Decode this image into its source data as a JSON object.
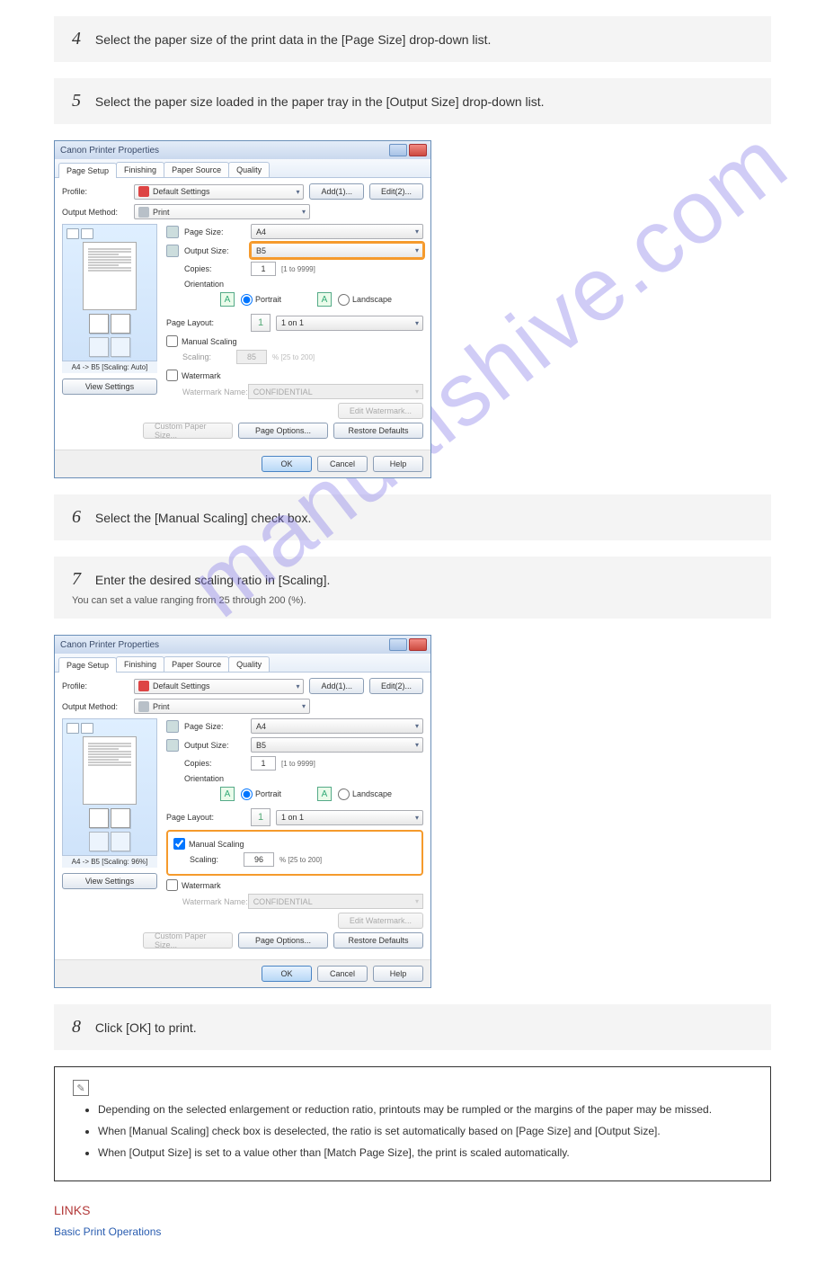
{
  "watermark": "manualshive.com",
  "steps": {
    "s4": {
      "num": "4",
      "text": "Select the paper size of the print data in the [Page Size] drop-down list."
    },
    "s5": {
      "num": "5",
      "text": "Select the paper size loaded in the paper tray in the [Output Size] drop-down list."
    },
    "s6": {
      "num": "6",
      "text": "Select the [Manual Scaling] check box."
    },
    "s7": {
      "num": "7",
      "text": "Enter the desired scaling ratio in [Scaling].",
      "sub": "You can set a value ranging from 25 through 200 (%)."
    },
    "s8": {
      "num": "8",
      "text": "Click [OK] to print."
    }
  },
  "dialog": {
    "title": "Canon Printer Properties",
    "tabs": {
      "t1": "Page Setup",
      "t2": "Finishing",
      "t3": "Paper Source",
      "t4": "Quality"
    },
    "profile_label": "Profile:",
    "profile_value": "Default Settings",
    "output_method_label": "Output Method:",
    "output_method_value": "Print",
    "add_btn": "Add(1)...",
    "edit_btn": "Edit(2)...",
    "page_size_label": "Page Size:",
    "page_size_value": "A4",
    "output_size_label": "Output Size:",
    "output_size_value": "B5",
    "copies_label": "Copies:",
    "copies_value": "1",
    "copies_range": "[1 to 9999]",
    "orientation_label": "Orientation",
    "portrait": "Portrait",
    "landscape": "Landscape",
    "page_layout_label": "Page Layout:",
    "page_layout_value": "1 on 1",
    "manual_scaling": "Manual Scaling",
    "scaling_label": "Scaling:",
    "scaling_value_dis": "85",
    "scaling_value_en": "96",
    "scaling_range": "% [25 to 200]",
    "watermark": "Watermark",
    "watermark_name": "Watermark Name:",
    "watermark_value": "CONFIDENTIAL",
    "edit_watermark": "Edit Watermark...",
    "custom_paper": "Custom Paper Size...",
    "page_options": "Page Options...",
    "restore_defaults": "Restore Defaults",
    "ok": "OK",
    "cancel": "Cancel",
    "help": "Help",
    "preview1_txt": "A4 -> B5 [Scaling: Auto]",
    "preview2_txt": "A4 -> B5 [Scaling: 96%]",
    "view_settings": "View Settings"
  },
  "notes": {
    "note1": "Depending on the selected enlargement or reduction ratio, printouts may be rumpled or the margins of the paper may be missed.",
    "note2": "When [Manual Scaling] check box is deselected, the ratio is set automatically based on [Page Size] and [Output Size].",
    "note3": "When [Output Size] is set to a value other than [Match Page Size], the print is scaled automatically."
  },
  "links": {
    "heading": "LINKS",
    "link1": "Basic Print Operations"
  }
}
